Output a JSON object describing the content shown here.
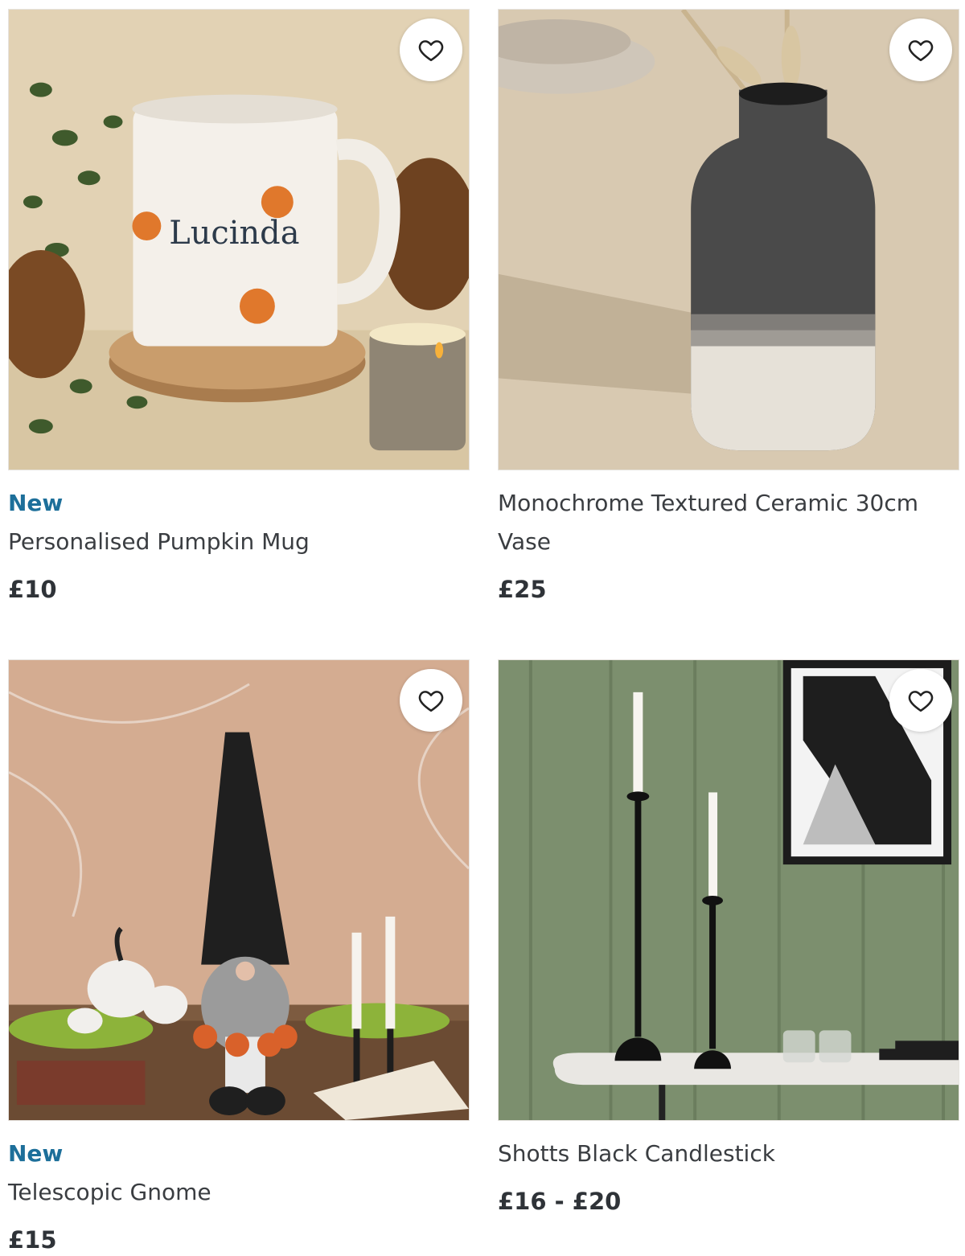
{
  "products": [
    {
      "badge": "New",
      "title": "Personalised Pumpkin Mug",
      "price": "£10",
      "image_text": "Lucinda",
      "image_alt": "pumpkin-mug-image"
    },
    {
      "badge": "",
      "title": "Monochrome Textured Ceramic 30cm Vase",
      "price": "£25",
      "image_alt": "ceramic-vase-image"
    },
    {
      "badge": "New",
      "title": "Telescopic Gnome",
      "price": "£15",
      "image_alt": "gnome-image"
    },
    {
      "badge": "",
      "title": "Shotts Black Candlestick",
      "price": "£16 - £20",
      "image_alt": "candlestick-image"
    }
  ],
  "icons": {
    "favourite": "heart-outline-icon"
  },
  "colors": {
    "badge": "#1d6f9a",
    "text": "#3a3d41",
    "price": "#2f3338"
  }
}
